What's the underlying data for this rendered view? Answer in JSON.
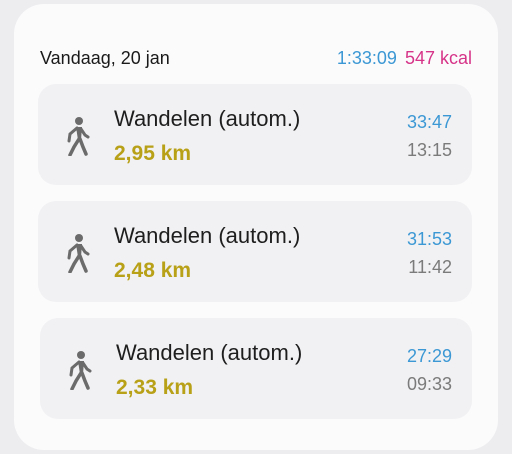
{
  "header": {
    "date": "Vandaag, 20 jan",
    "total_duration": "1:33:09",
    "total_kcal": "547 kcal"
  },
  "colors": {
    "duration": "#3c98d4",
    "kcal": "#d63488",
    "distance": "#b8a017",
    "icon": "#6b6b6b"
  },
  "activities": [
    {
      "icon": "walking-icon",
      "title": "Wandelen (autom.)",
      "distance": "2,95 km",
      "duration": "33:47",
      "time": "13:15"
    },
    {
      "icon": "walking-icon",
      "title": "Wandelen (autom.)",
      "distance": "2,48 km",
      "duration": "31:53",
      "time": "11:42"
    },
    {
      "icon": "walking-icon",
      "title": "Wandelen (autom.)",
      "distance": "2,33 km",
      "duration": "27:29",
      "time": "09:33"
    }
  ]
}
